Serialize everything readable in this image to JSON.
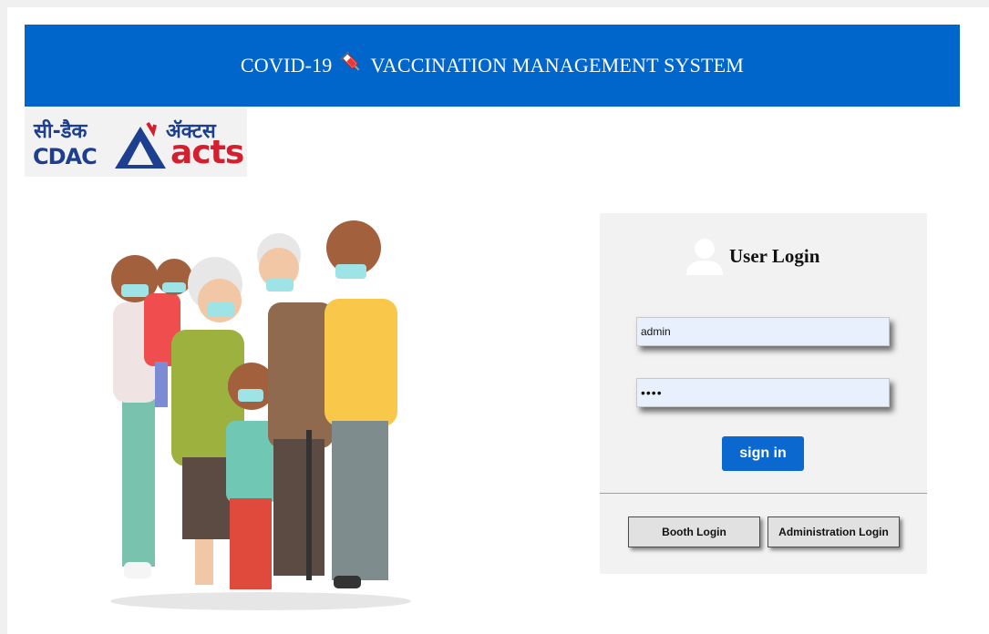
{
  "header": {
    "title_left": "COVID-19",
    "title_right": "VACCINATION MANAGEMENT SYSTEM",
    "icon": "syringe-icon",
    "background": "#0066cc"
  },
  "logo": {
    "hindi_left": "सी-डैक",
    "cdac": "CDAC",
    "hindi_right": "ॲक्टस",
    "acts": "acts"
  },
  "login": {
    "title": "User Login",
    "username_value": "admin",
    "password_value": "••••",
    "signin_label": "sign in",
    "booth_login_label": "Booth Login",
    "admin_login_label": "Administration Login"
  },
  "colors": {
    "accent": "#0a68cf",
    "panel": "#f2f2f2",
    "field": "#e8f0fe"
  }
}
